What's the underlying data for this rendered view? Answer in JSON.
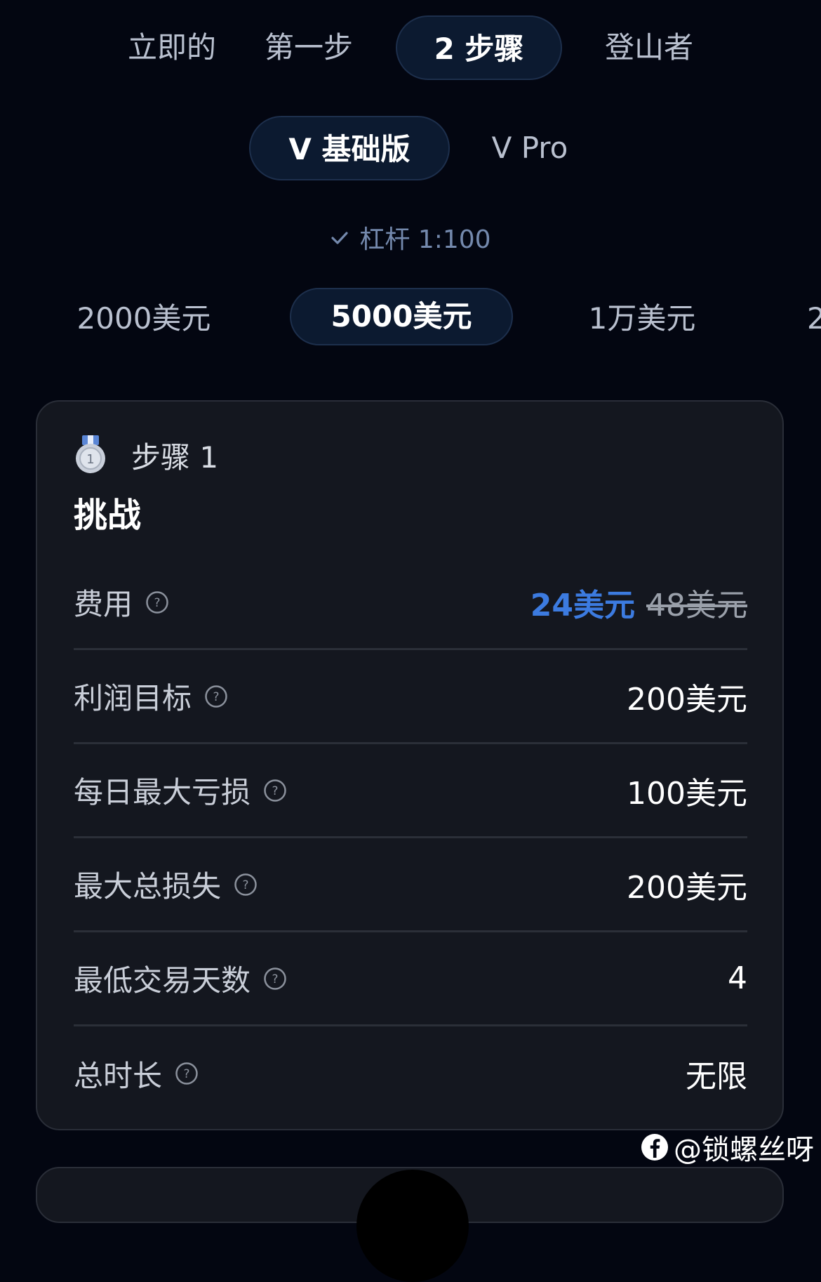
{
  "challenge_type_tabs": [
    {
      "label": "立即的",
      "active": false
    },
    {
      "label": "第一步",
      "active": false
    },
    {
      "label": "2 步骤",
      "active": true
    },
    {
      "label": "登山者",
      "active": false
    }
  ],
  "plan_tabs": [
    {
      "label": "V 基础版",
      "active": true
    },
    {
      "label": "V Pro",
      "active": false
    }
  ],
  "leverage": {
    "label": "杠杆 1:100",
    "icon": "check-icon"
  },
  "account_size_tabs": [
    {
      "label": "2000美元",
      "active": false
    },
    {
      "label": "5000美元",
      "active": true
    },
    {
      "label": "1万美元",
      "active": false
    },
    {
      "label": "2",
      "active": false
    }
  ],
  "card": {
    "medal_icon": "medal-1-icon",
    "step_label": "步骤 1",
    "title": "挑战",
    "rules": [
      {
        "label": "费用",
        "price": "24美元",
        "old_price": "48美元"
      },
      {
        "label": "利润目标",
        "value": "200美元"
      },
      {
        "label": "每日最大亏损",
        "value": "100美元"
      },
      {
        "label": "最大总损失",
        "value": "200美元"
      },
      {
        "label": "最低交易天数",
        "value": "4"
      },
      {
        "label": "总时长",
        "value": "无限"
      }
    ]
  },
  "watermark": {
    "icon": "facebook-icon",
    "text": "@锁螺丝呀"
  },
  "colors": {
    "background": "#030611",
    "card": "#14171f",
    "accent_blue": "#3c7be0",
    "active_pill": "#0c1a30"
  }
}
